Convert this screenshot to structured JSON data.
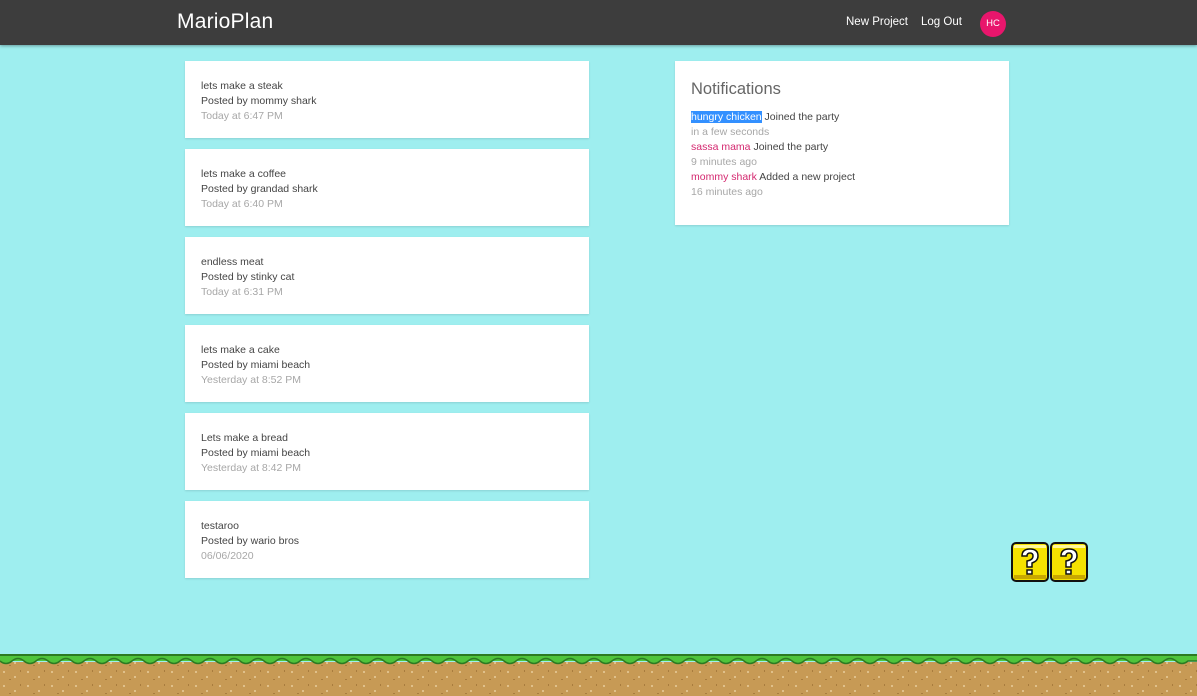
{
  "navbar": {
    "brand": "MarioPlan",
    "links": [
      "New Project",
      "Log Out"
    ],
    "avatar_initials": "HC",
    "avatar_color": "#e8166c"
  },
  "projects": [
    {
      "title": "lets make a steak",
      "author": "Posted by mommy shark",
      "time": "Today at 6:47 PM"
    },
    {
      "title": "lets make a coffee",
      "author": "Posted by grandad shark",
      "time": "Today at 6:40 PM"
    },
    {
      "title": "endless meat",
      "author": "Posted by stinky cat",
      "time": "Today at 6:31 PM"
    },
    {
      "title": "lets make a cake",
      "author": "Posted by miami beach",
      "time": "Yesterday at 8:52 PM"
    },
    {
      "title": "Lets make a bread",
      "author": "Posted by miami beach",
      "time": "Yesterday at 8:42 PM"
    },
    {
      "title": "testaroo",
      "author": "Posted by wario bros",
      "time": "06/06/2020"
    }
  ],
  "notifications": {
    "title": "Notifications",
    "items": [
      {
        "user": "hungry chicken",
        "action": "Joined the party",
        "time": "in a few seconds"
      },
      {
        "user": "sassa mama",
        "action": "Joined the party",
        "time": "9 minutes ago"
      },
      {
        "user": "mommy shark",
        "action": "Added a new project",
        "time": "16 minutes ago"
      }
    ]
  },
  "colors": {
    "background": "#9eeeef",
    "navbar": "#3d3d3d",
    "accent_pink": "#d4276f",
    "selection": "#3390ff"
  }
}
